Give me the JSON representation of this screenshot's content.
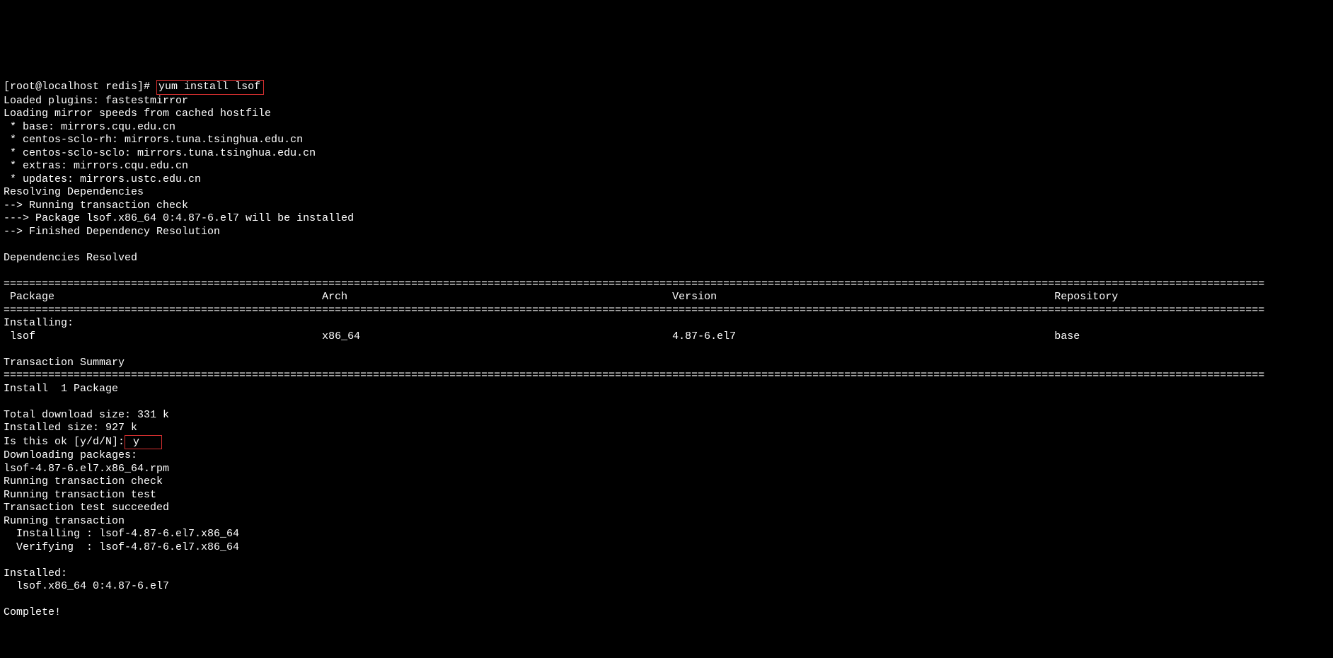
{
  "prompt": {
    "user_host": "[root@localhost redis]# ",
    "command": "yum install lsof"
  },
  "body1": "Loaded plugins: fastestmirror\nLoading mirror speeds from cached hostfile\n * base: mirrors.cqu.edu.cn\n * centos-sclo-rh: mirrors.tuna.tsinghua.edu.cn\n * centos-sclo-sclo: mirrors.tuna.tsinghua.edu.cn\n * extras: mirrors.cqu.edu.cn\n * updates: mirrors.ustc.edu.cn\nResolving Dependencies\n--> Running transaction check\n---> Package lsof.x86_64 0:4.87-6.el7 will be installed\n--> Finished Dependency Resolution\n\nDependencies Resolved\n",
  "full_rule": "======================================================================================================================================================================================================",
  "table_header": " Package                                          Arch                                                   Version                                                     Repository",
  "body2": "Installing:",
  "table_row": " lsof                                             x86_64                                                 4.87-6.el7                                                  base",
  "body3": "\nTransaction Summary",
  "body4": "Install  1 Package\n\nTotal download size: 331 k\nInstalled size: 927 k",
  "confirm_prompt": "Is this ok [y/d/N]:",
  "confirm_answer": " y   ",
  "body5": "Downloading packages:\nlsof-4.87-6.el7.x86_64.rpm\nRunning transaction check\nRunning transaction test\nTransaction test succeeded\nRunning transaction\n  Installing : lsof-4.87-6.el7.x86_64\n  Verifying  : lsof-4.87-6.el7.x86_64\n\nInstalled:\n  lsof.x86_64 0:4.87-6.el7\n\nComplete!"
}
